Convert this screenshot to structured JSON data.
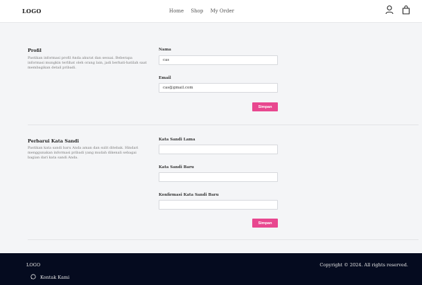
{
  "header": {
    "logo": "LOGO",
    "nav": [
      "Home",
      "Shop",
      "My Order"
    ],
    "icons": [
      "user-icon",
      "shopping-bag-icon"
    ]
  },
  "profile": {
    "title": "Profil",
    "description": "Pastikan informasi profil Anda akurat dan sesuai. Beberapa informasi mungkin terlihat oleh orang lain, jadi berhati-hatilah saat membagikan detail pribadi.",
    "name_label": "Nama",
    "name_value": "cas",
    "email_label": "Email",
    "email_value": "cas@gmail.com",
    "save_label": "Simpan"
  },
  "password": {
    "title": "Perbarui Kata Sandi",
    "description": "Pastikan kata sandi baru Anda aman dan sulit ditebak. Hindari menggunakan informasi pribadi yang mudah dikenali sebagai bagian dari kata sandi Anda.",
    "old_label": "Kata Sandi Lama",
    "new_label": "Kata Sandi Baru",
    "confirm_label": "Konfirmasi Kata Sandi Baru",
    "save_label": "Simpan"
  },
  "footer": {
    "logo": "LOGO",
    "copyright": "Copyright © 2024. All rights reserved.",
    "contact": "Kontak Kami",
    "contact_icon": "whatsapp-icon"
  },
  "colors": {
    "accent": "#e8478f",
    "footer_bg": "#050b1f",
    "page_bg": "#f4f5f7"
  }
}
